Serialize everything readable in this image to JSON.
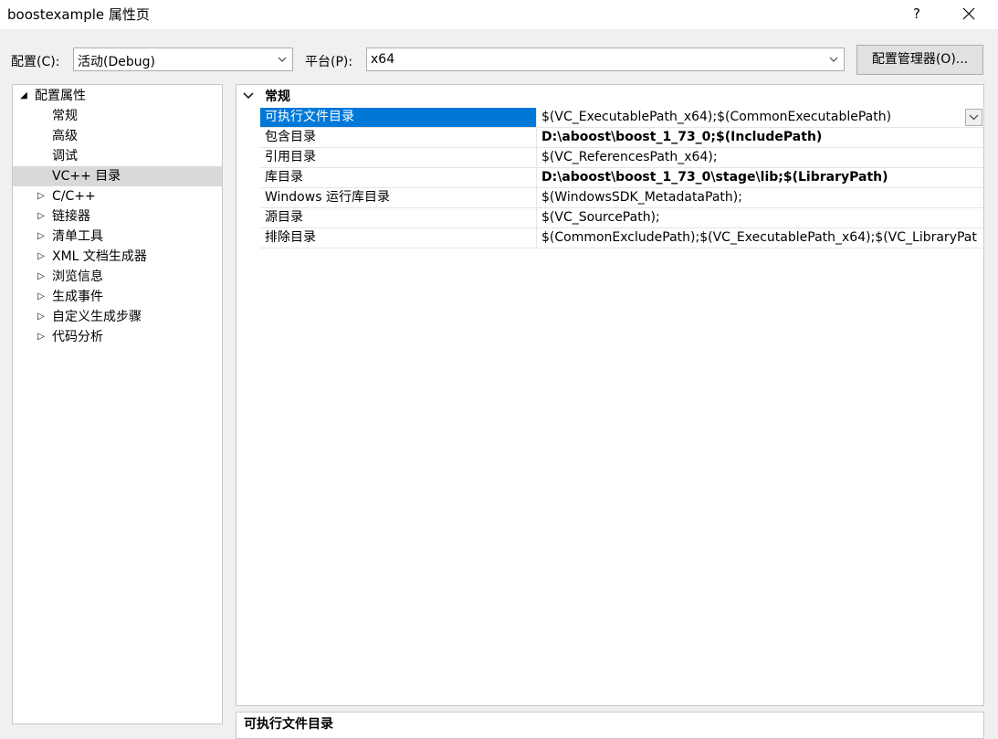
{
  "window": {
    "title": "boostexample 属性页",
    "help_label": "?",
    "close_icon": "close-icon"
  },
  "toolbar": {
    "config_label": "配置(C):",
    "config_value": "活动(Debug)",
    "platform_label": "平台(P):",
    "platform_value": "x64",
    "config_manager_label": "配置管理器(O)..."
  },
  "tree": {
    "root_label": "配置属性",
    "children": [
      "常规",
      "高级",
      "调试",
      "VC++ 目录"
    ],
    "selected": "VC++ 目录",
    "groups": [
      "C/C++",
      "链接器",
      "清单工具",
      "XML 文档生成器",
      "浏览信息",
      "生成事件",
      "自定义生成步骤",
      "代码分析"
    ]
  },
  "grid": {
    "category": "常规",
    "properties": [
      {
        "name": "可执行文件目录",
        "value": "$(VC_ExecutablePath_x64);$(CommonExecutablePath)"
      },
      {
        "name": "包含目录",
        "value": "D:\\aboost\\boost_1_73_0;$(IncludePath)"
      },
      {
        "name": "引用目录",
        "value": "$(VC_ReferencesPath_x64);"
      },
      {
        "name": "库目录",
        "value": "D:\\aboost\\boost_1_73_0\\stage\\lib;$(LibraryPath)"
      },
      {
        "name": "Windows 运行库目录",
        "value": "$(WindowsSDK_MetadataPath);"
      },
      {
        "name": "源目录",
        "value": "$(VC_SourcePath);"
      },
      {
        "name": "排除目录",
        "value": "$(CommonExcludePath);$(VC_ExecutablePath_x64);$(VC_LibraryPat"
      }
    ]
  },
  "description": {
    "title": "可执行文件目录"
  },
  "colors": {
    "selection": "#0078d7",
    "tree_selection": "#d9d9d9",
    "background": "#f0f0f0"
  }
}
